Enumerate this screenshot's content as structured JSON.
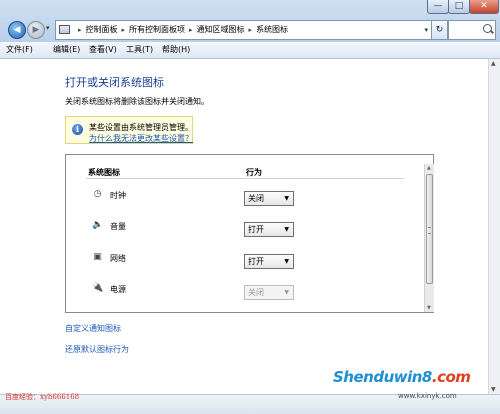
{
  "window": {
    "minimize": "—",
    "maximize": "□",
    "close": "✕"
  },
  "address": {
    "crumbs": [
      "控制面板",
      "所有控制面板项",
      "通知区域图标",
      "系统图标"
    ],
    "separator": "▸"
  },
  "menu": [
    "文件(F)",
    "编辑(E)",
    "查看(V)",
    "工具(T)",
    "帮助(H)"
  ],
  "page": {
    "title": "打开或关闭系统图标",
    "description": "关闭系统图标将删除该图标并关闭通知。",
    "info_text": "某些设置由系统管理员管理。",
    "info_link": "为什么我无法更改某些设置？"
  },
  "table": {
    "col_icon": "系统图标",
    "col_behavior": "行为",
    "rows": [
      {
        "icon": "clock-icon",
        "label": "时钟",
        "value": "关闭",
        "enabled": true
      },
      {
        "icon": "volume-icon",
        "label": "音量",
        "value": "打开",
        "enabled": true
      },
      {
        "icon": "network-icon",
        "label": "网络",
        "value": "打开",
        "enabled": true
      },
      {
        "icon": "power-icon",
        "label": "电源",
        "value": "关闭",
        "enabled": false
      }
    ]
  },
  "links": {
    "customize": "自定义通知图标",
    "restore": "还原默认图标行为"
  },
  "watermarks": {
    "left": "百度经验：xyh666168",
    "logo_main": "Shenduwin8",
    "logo_tld": ".com",
    "url": "www.kxinyk.com"
  }
}
